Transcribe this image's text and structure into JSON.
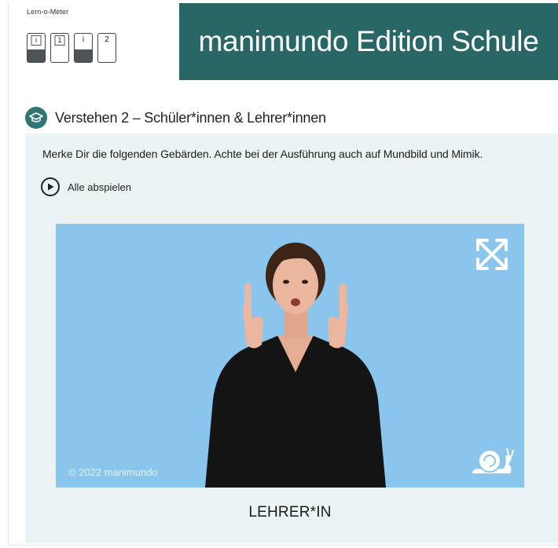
{
  "lern_o_meter": {
    "label": "Lern-o-Meter",
    "levels": [
      {
        "text": "i",
        "fill": 0.45
      },
      {
        "text": "1",
        "fill": 0
      },
      {
        "text": "i",
        "fill": 0.45
      },
      {
        "text": "2",
        "fill": 0
      }
    ]
  },
  "banner": {
    "title": "manimundo Edition Schule"
  },
  "section": {
    "icon": "graduation-cap-icon",
    "title": "Verstehen 2 – Schüler*innen & Lehrer*innen"
  },
  "instruction": "Merke Dir die folgenden Gebärden. Achte bei der Ausführung auch auf Mundbild und Mimik.",
  "play_all": {
    "icon": "play-circle-icon",
    "label": "Alle abspielen"
  },
  "video": {
    "copyright": "© 2022 manimundo",
    "expand_icon": "expand-arrows-icon",
    "slow_icon": "snail-icon",
    "background": "#8ac5ee"
  },
  "caption": "LEHRER*IN",
  "colors": {
    "banner": "#286766",
    "accent": "#2f7672",
    "panel": "#ecf3f5"
  }
}
